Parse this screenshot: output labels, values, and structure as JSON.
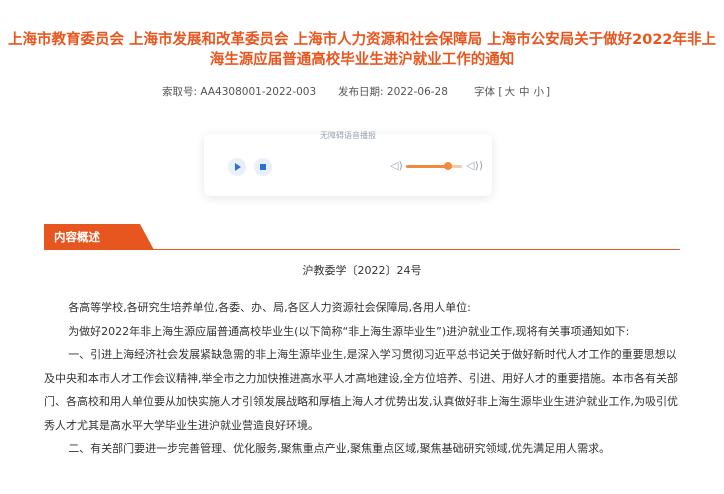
{
  "title": {
    "line1": "上海市教育委员会 上海市发展和改革委员会 上海市人力资源和社会保障局 上海市公安局关于做好2022年非上",
    "line2": "海生源应届普通高校毕业生进沪就业工作的通知"
  },
  "meta": {
    "index_label": "索取号:",
    "index_value": "AA4308001-2022-003",
    "date_label": "发布日期:",
    "date_value": "2022-06-28",
    "font_label": "字体",
    "font_open": "[",
    "font_large": "大",
    "font_medium": "中",
    "font_small": "小",
    "font_close": "]"
  },
  "player": {
    "label": "无障碍语音播报",
    "volume_level": 0.75
  },
  "section": {
    "tab_label": "内容概述"
  },
  "doc": {
    "number": "沪教委学〔2022〕24号",
    "paragraphs": [
      "各高等学校,各研究生培养单位,各委、办、局,各区人力资源社会保障局,各用人单位:",
      "为做好2022年非上海生源应届普通高校毕业生(以下简称“非上海生源毕业生”)进沪就业工作,现将有关事项通知如下:",
      "一、引进上海经济社会发展紧缺急需的非上海生源毕业生,是深入学习贯彻习近平总书记关于做好新时代人才工作的重要思想以及中央和本市人才工作会议精神,举全市之力加快推进高水平人才高地建设,全方位培养、引进、用好人才的重要措施。本市各有关部门、各高校和用人单位要从加快实施人才引领发展战略和厚植上海人才优势出发,认真做好非上海生源毕业生进沪就业工作,为吸引优秀人才尤其是高水平大学毕业生进沪就业营造良好环境。",
      "二、有关部门要进一步完善管理、优化服务,聚焦重点产业,聚焦重点区域,聚焦基础研究领域,优先满足用人需求。"
    ]
  },
  "colors": {
    "accent": "#e8561f",
    "player_accent": "#2f6fd8"
  }
}
